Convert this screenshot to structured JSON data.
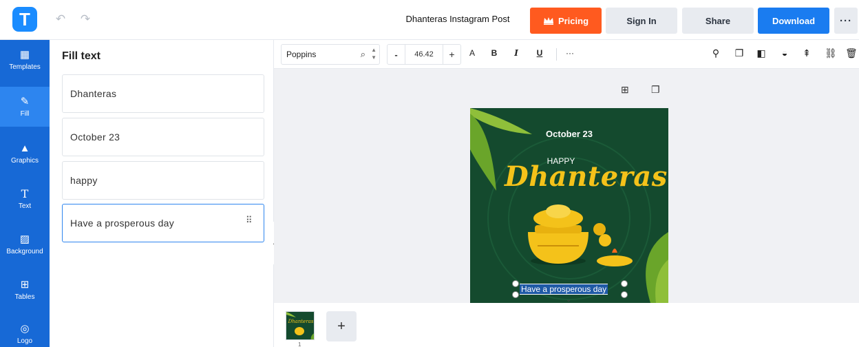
{
  "header": {
    "logo_letter": "T",
    "undo_icon": "undo-icon",
    "redo_icon": "redo-icon",
    "doc_title": "Dhanteras Instagram Post",
    "pricing_label": "Pricing",
    "signin_label": "Sign In",
    "share_label": "Share",
    "download_label": "Download",
    "more_label": "···"
  },
  "sidebar": {
    "items": [
      {
        "label": "Templates",
        "icon": "templates-icon",
        "active": false
      },
      {
        "label": "Fill",
        "icon": "pencil-icon",
        "active": true
      },
      {
        "label": "Graphics",
        "icon": "shapes-icon",
        "active": false
      },
      {
        "label": "Text",
        "icon": "text-icon",
        "active": false
      },
      {
        "label": "Background",
        "icon": "background-icon",
        "active": false
      },
      {
        "label": "Tables",
        "icon": "table-icon",
        "active": false
      },
      {
        "label": "Logo",
        "icon": "logo-icon",
        "active": false
      }
    ]
  },
  "panel": {
    "title": "Fill text",
    "fields": [
      "Dhanteras",
      "October 23",
      "happy",
      "Have a prosperous day"
    ]
  },
  "toolbar": {
    "font": "Poppins",
    "size_minus": "-",
    "size": "46.42",
    "size_plus": "+",
    "font_a": "A",
    "bold": "B",
    "italic": "I",
    "underline": "U",
    "more": "···"
  },
  "artboard": {
    "date": "October 23",
    "happy": "HAPPY",
    "title": "Dhanteras",
    "subtitle": "Have a prosperous day",
    "background": "#144a2e",
    "title_color": "#f4c21a"
  },
  "pages": {
    "current": "1",
    "add_label": "+"
  },
  "colors": {
    "brand": "#1a8cff",
    "rail": "#1769d6",
    "pricing": "#ff5a1f",
    "download": "#1a7cf0"
  }
}
